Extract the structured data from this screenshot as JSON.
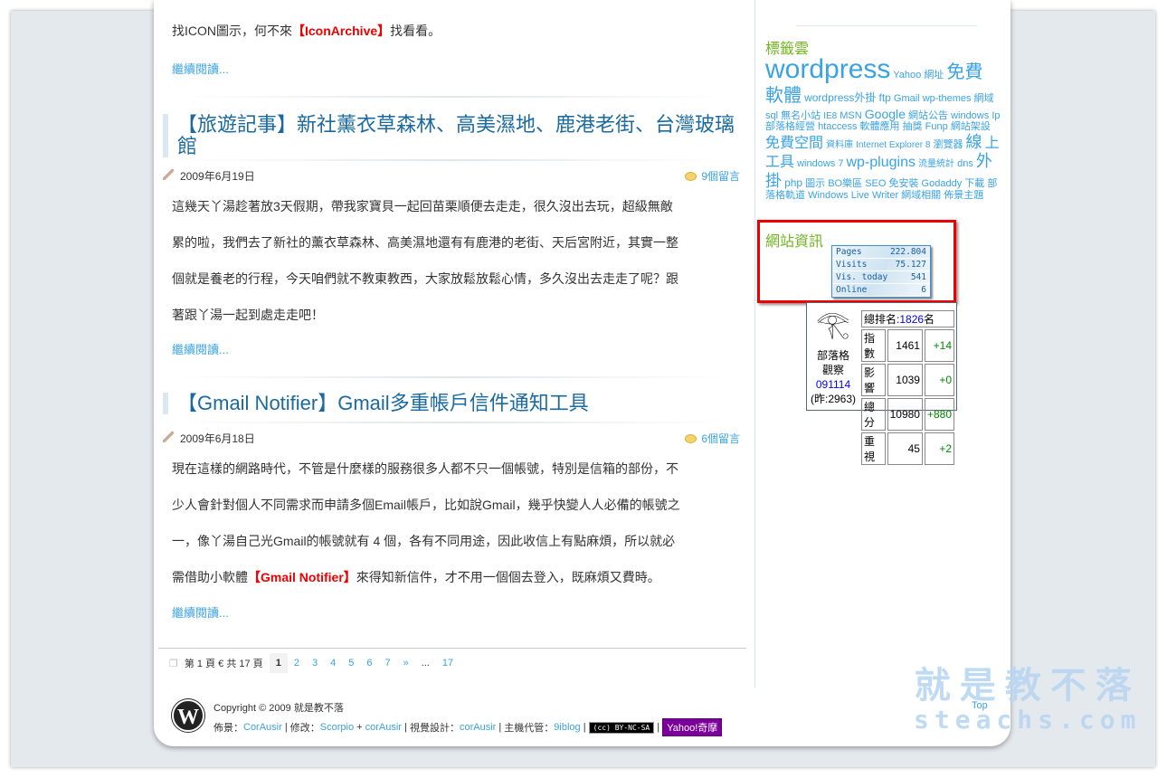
{
  "post0": {
    "text_a": "找ICON圖示，何不來",
    "highlight": "【IconArchive】",
    "text_b": "找看看。",
    "more": "繼續閱讀..."
  },
  "post1": {
    "title": "【旅遊記事】新社薰衣草森林、高美濕地、鹿港老街、台灣玻璃館",
    "date": "2009年6月19日",
    "comments": "9個留言",
    "lines": [
      "這幾天丫湯趁著放3天假期，帶我家寶貝一起回苗栗順便去走走，很久沒出去玩，超級無敵",
      "累的啦，我們去了新社的薰衣草森林、高美濕地還有有鹿港的老街、天后宮附近，其實一整",
      "個就是養老的行程，今天咱們就不教東教西，大家放鬆放鬆心情，多久沒出去走走了呢？跟",
      "著跟丫湯一起到處走走吧！"
    ],
    "more": "繼續閱讀..."
  },
  "post2": {
    "title": "【Gmail Notifier】Gmail多重帳戶信件通知工具",
    "date": "2009年6月18日",
    "comments": "6個留言",
    "lines": [
      "現在這樣的網路時代，不管是什麼樣的服務很多人都不只一個帳號，特別是信箱的部份，不",
      "少人會針對個人不同需求而申請多個Email帳戶，比如說Gmail，幾乎快變人人必備的帳號之",
      "一，像丫湯自己光Gmail的帳號就有 4 個，各有不同用途，因此收信上有點麻煩，所以就必"
    ],
    "line4_a": "需借助小軟體",
    "highlight": "【Gmail Notifier】",
    "line4_b": "來得知新信件，才不用一個個去登入，既麻煩又費時。",
    "more": "繼續閱讀..."
  },
  "pager": {
    "info": "第 1 頁 € 共 17 頁",
    "current": "1",
    "pages": [
      "2",
      "3",
      "4",
      "5",
      "6",
      "7",
      "»",
      "...",
      "17"
    ]
  },
  "sidebar": {
    "tags_title": "標籤雲",
    "tags": [
      [
        "wordpress",
        30
      ],
      [
        "Yahoo",
        11
      ],
      [
        "網址",
        11
      ],
      [
        "免費",
        20
      ],
      [
        "軟體",
        20
      ],
      [
        "wordpress外掛",
        12
      ],
      [
        "ftp",
        12
      ],
      [
        "Gmail",
        11
      ],
      [
        "wp-themes",
        11
      ],
      [
        "網域",
        11
      ],
      [
        "sql",
        11
      ],
      [
        "無名小站",
        11
      ],
      [
        "IE8",
        10
      ],
      [
        "MSN",
        11
      ],
      [
        "Google",
        14
      ],
      [
        "網站公告",
        11
      ],
      [
        "windows",
        11
      ],
      [
        "Ip",
        11
      ],
      [
        "部落格經營",
        11
      ],
      [
        "htaccess",
        11
      ],
      [
        "軟體應用",
        11
      ],
      [
        "抽獎",
        11
      ],
      [
        "Funp",
        11
      ],
      [
        "網站架設",
        11
      ],
      [
        "免費空間",
        16
      ],
      [
        "資料庫",
        10
      ],
      [
        "Internet Explorer 8",
        10
      ],
      [
        "瀏覽器",
        11
      ],
      [
        "線",
        18
      ],
      [
        "上工具",
        16
      ],
      [
        "windows 7",
        11
      ],
      [
        "wp-plugins",
        16
      ],
      [
        "流量統計",
        10
      ],
      [
        "dns",
        11
      ],
      [
        "外掛",
        18
      ],
      [
        "php",
        12
      ],
      [
        "圖示",
        11
      ],
      [
        "BO樂區",
        11
      ],
      [
        "SEO",
        11
      ],
      [
        "免安裝",
        11
      ],
      [
        "Godaddy",
        11
      ],
      [
        "下載",
        11
      ],
      [
        "部落格軌道",
        11
      ],
      [
        "Windows Live Writer",
        11
      ],
      [
        "網域相關",
        11
      ],
      [
        "佈景主題",
        11
      ]
    ],
    "info_title": "網站資訊",
    "stats": [
      [
        "Pages",
        "222.804"
      ],
      [
        "Visits",
        "75.127"
      ],
      [
        "Vis. today",
        "541"
      ],
      [
        "Online",
        "6"
      ]
    ],
    "rank": {
      "total_label": "總排名:",
      "total": "1826",
      "total_unit": "名",
      "name1": "部落格",
      "name2": "觀察",
      "date": "091114",
      "yesterday": "(昨:2963)",
      "rows": [
        [
          "指數",
          "1461",
          "+14"
        ],
        [
          "影響",
          "1039",
          "+0"
        ],
        [
          "總分",
          "10980",
          "+880"
        ],
        [
          "重視",
          "45",
          "+2"
        ]
      ]
    }
  },
  "footer": {
    "copyright": "Copyright © 2009 就是教不落",
    "theme_label": "佈景：",
    "theme": "CorAusir",
    "mod_label": "修改：",
    "mod1": "Scorpio",
    "plus": " + ",
    "mod2": "corAusir",
    "design_label": "視覺設計：",
    "design": "corAusir",
    "host_label": "主機代管：",
    "host": "9iblog",
    "cc": "BY-NC-SA",
    "yahoo": "Yahoo!奇摩",
    "top": "Top"
  },
  "watermark": {
    "line1": "就是教不落",
    "line2": "steachs.com"
  }
}
